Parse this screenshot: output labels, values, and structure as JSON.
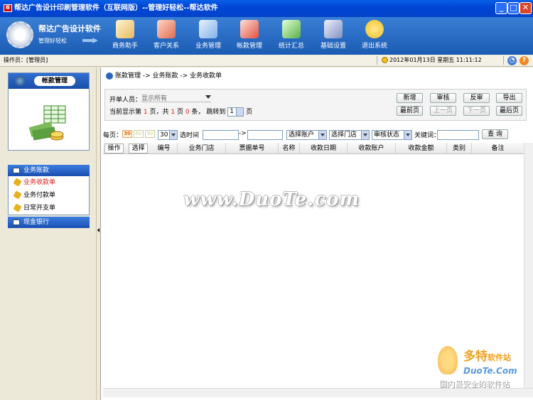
{
  "window": {
    "title": "帮达广告设计印刷管理软件（互联网版）--管理好轻松--帮达软件",
    "icon": "app-icon"
  },
  "banner": {
    "brand": "帮达广告设计软件",
    "slogan": "管理好轻松",
    "tools": [
      {
        "label": "商务助手",
        "icon": "clipboard-check-icon",
        "color": "#e8b860"
      },
      {
        "label": "客户关系",
        "icon": "people-icon",
        "color": "#e06b50"
      },
      {
        "label": "业务管理",
        "icon": "notebook-pen-icon",
        "color": "#7fb0e8"
      },
      {
        "label": "帐款管理",
        "icon": "exchange-icon",
        "color": "#e05040"
      },
      {
        "label": "统计汇总",
        "icon": "bar-chart-icon",
        "color": "#58b048"
      },
      {
        "label": "基础设置",
        "icon": "calendar-icon",
        "color": "#8090c0"
      },
      {
        "label": "退出系统",
        "icon": "exit-figure-icon",
        "color": "#f0c020"
      }
    ]
  },
  "opbar": {
    "operator_label": "操作员：[管理员]",
    "datetime": "2012年01月13日  星期五   11:11:12"
  },
  "left": {
    "panel_title": "帐款管理",
    "nav_group1": "业务账款",
    "nav_items": [
      "业务收款单",
      "业务付款单",
      "日常开支单"
    ],
    "nav_group2": "现金银行"
  },
  "main": {
    "breadcrumb": "账款管理 -> 业务账款 -> 业务收款单",
    "filter": {
      "creator_label": "开单人员：",
      "creator_value": "显示所有",
      "page_text_a": "当前显示第",
      "current_page": "1",
      "page_text_b": "页，共",
      "total_pages": "1",
      "page_text_c": "页",
      "total_items": "0",
      "page_text_d": "条，  跳转到",
      "jump_value": "1",
      "page_text_e": "页"
    },
    "buttons": [
      "新增",
      "审核",
      "反审",
      "导出"
    ],
    "nav_buttons": [
      "最前页",
      "上一页",
      "下一页",
      "最后页"
    ],
    "toolbar": {
      "per_page_label": "每页：",
      "size_opts": [
        "30",
        "60",
        "90"
      ],
      "size_value": "30",
      "time_label": "选时间",
      "range_sep": "->",
      "account_select": "选择账户",
      "store_select": "选择门店",
      "status_select": "审核状态",
      "keyword_label": "关键词：",
      "search_button": "查 询"
    },
    "columns": [
      "操作",
      "选择",
      "编号",
      "业务门店",
      "票据单号",
      "名称",
      "收款日期",
      "收款账户",
      "收款金额",
      "类别",
      "备注"
    ]
  },
  "watermark": "www.DuoTe.com",
  "corner": {
    "line1a": "多特",
    "line1b": "软件站",
    "line2": "DuoTe.Com",
    "line3": "国内最安全的软件站"
  }
}
